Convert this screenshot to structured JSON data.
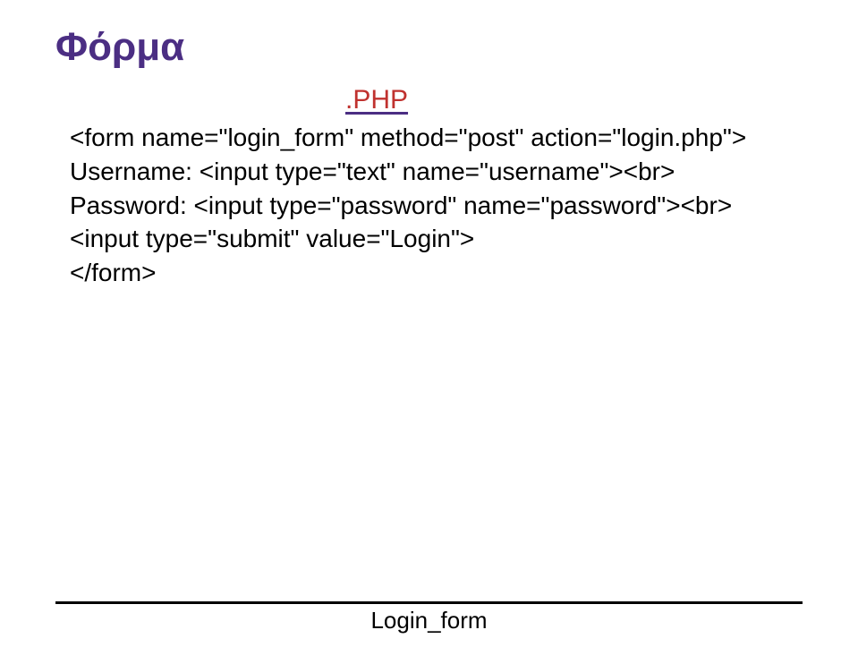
{
  "title": "Φόρμα",
  "php_label": ".PHP",
  "code": {
    "line1": "<form name=\"login_form\" method=\"post\" action=\"login.php\">",
    "line2": "Username: <input type=\"text\" name=\"username\"><br>",
    "line3": "Password: <input type=\"password\" name=\"password\"><br>",
    "line4": "<input type=\"submit\" value=\"Login\">",
    "line5": "</form>"
  },
  "footer": "Login_form"
}
